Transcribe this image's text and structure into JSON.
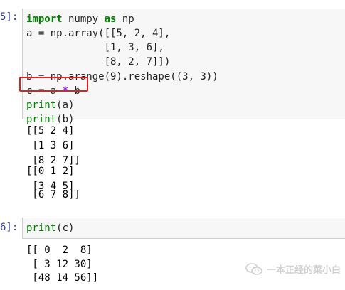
{
  "cells": [
    {
      "prompt": "5]:",
      "code_lines": [
        [
          "import",
          " numpy ",
          "as",
          " np"
        ],
        [
          "a = np.array([[5, 2, 4],"
        ],
        [
          "             [1, 3, 6],"
        ],
        [
          "             [8, 2, 7]])"
        ],
        [
          "b = np.arange(9).reshape((3, 3))"
        ],
        [
          "c = a ",
          "*",
          " b"
        ],
        [
          "print",
          "(a)"
        ],
        [
          "print",
          "(b)"
        ]
      ],
      "output_lines": [
        "[[5 2 4]",
        " [1 3 6]",
        " [8 2 7]]",
        "[[0 1 2]",
        " [3 4 5]",
        " [6 7 8]]"
      ]
    },
    {
      "prompt": "6]:",
      "code_lines": [
        [
          "print",
          "(c)"
        ]
      ],
      "output_lines": [
        "[[ 0  2  8]",
        " [ 3 12 30]",
        " [48 14 56]]"
      ]
    }
  ],
  "watermark": {
    "text": "一本正经的菜小白",
    "icon": "wechat-icon"
  },
  "colors": {
    "keyword": "#008000",
    "operator": "#aa22ff",
    "highlight_border": "#e02020",
    "prompt": "#303f9f"
  }
}
